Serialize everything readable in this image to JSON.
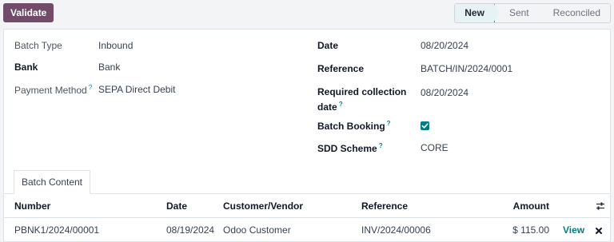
{
  "toolbar": {
    "validate_label": "Validate"
  },
  "statusbar": {
    "stages": [
      "New",
      "Sent",
      "Reconciled"
    ],
    "active": "New"
  },
  "left_fields": [
    {
      "label": "Batch Type",
      "value": "Inbound",
      "bold": false,
      "help": false
    },
    {
      "label": "Bank",
      "value": "Bank",
      "bold": true,
      "help": false
    },
    {
      "label": "Payment Method",
      "value": "SEPA Direct Debit",
      "bold": false,
      "help": true
    }
  ],
  "right_fields": {
    "date": {
      "label": "Date",
      "value": "08/20/2024"
    },
    "reference": {
      "label": "Reference",
      "value": "BATCH/IN/2024/0001"
    },
    "required_collection_date": {
      "label_line1": "Required collection",
      "label_line2": "date",
      "value": "08/20/2024"
    },
    "batch_booking": {
      "label": "Batch Booking",
      "checked": true
    },
    "sdd_scheme": {
      "label": "SDD Scheme",
      "value": "CORE"
    }
  },
  "help_marker": "?",
  "tabs": [
    {
      "label": "Batch Content"
    }
  ],
  "table": {
    "columns": [
      "Number",
      "Date",
      "Customer/Vendor",
      "Reference",
      "Amount"
    ],
    "rows": [
      {
        "number": "PBNK1/2024/00001",
        "date": "08/19/2024",
        "customer": "Odoo Customer",
        "reference": "INV/2024/00006",
        "amount": "$ 115.00",
        "action": "View"
      }
    ]
  },
  "icons": {
    "settings": "sliders-icon",
    "delete": "close-x-icon",
    "check": "checkmark-icon"
  },
  "colors": {
    "primary": "#714b67",
    "accent": "#017e84"
  }
}
